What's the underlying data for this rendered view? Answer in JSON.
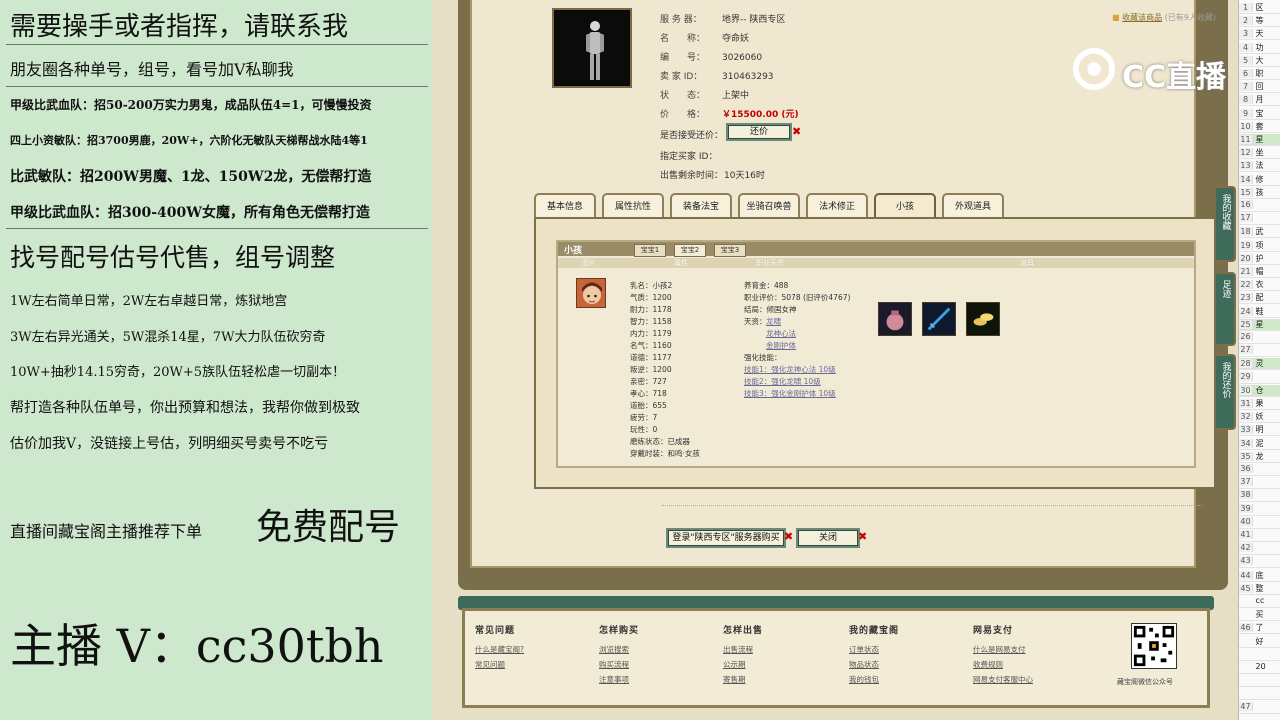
{
  "ad_panel": {
    "lines": [
      "需要操手或者指挥，请联系我",
      "朋友圈各种单号，组号，看号加V私聊我",
      "甲级比武血队：招50-200万实力男鬼，成品队伍4=1，可慢慢投资",
      "四上小资敏队：招3700男鹿，20W+，六阶化无敏队天梯帮战水陆4等1",
      "比武敏队：招200W男魔、1龙、150W2龙，无偿帮打造",
      "甲级比武血队：招300-400W女魔，所有角色无偿帮打造",
      "找号配号估号代售，组号调整",
      "1W左右简单日常，2W左右卓越日常，炼狱地宫",
      "3W左右异光通关，5W混杀14星，7W大力队伍砍穷奇",
      "10W+抽秒14.15穷奇，20W+5族队伍轻松虐一切副本！",
      "帮打造各种队伍单号，你出预算和想法，我帮你做到极致",
      "估价加我V，没链接上号估，列明细买号卖号不吃亏",
      "直播间藏宝阁主播推荐下单",
      "免费配号",
      "主播 V：cc30tbh"
    ]
  },
  "listing": {
    "server_label": "服 务 器：",
    "server_value": "地界-- 陕西专区",
    "name_label": "名　　称：",
    "name_value": "夺命妖",
    "id_label": "编　　号：",
    "id_value": "3026060",
    "seller_label": "卖 家 ID：",
    "seller_value": "310463293",
    "status_label": "状　　态：",
    "status_value": "上架中",
    "price_label": "价　　格：",
    "price_value": "￥15500.00 (元)",
    "counter_label": "是否接受还价：",
    "counter_button": "还价",
    "buyer_label": "指定买家 ID：",
    "buyer_value": "",
    "time_label": "出售剩余时间：",
    "time_value": "10天16时",
    "favorite_link": "收藏该商品",
    "favorite_count": "(已有9人收藏)"
  },
  "tabs": [
    "基本信息",
    "属性抗性",
    "装备法宝",
    "坐骑召唤兽",
    "法术修正",
    "小孩",
    "外观道具"
  ],
  "active_tab": "小孩",
  "child_panel": {
    "title": "小孩",
    "sub_tabs": [
      "宝宝1",
      "宝宝2",
      "宝宝3"
    ],
    "headers": [
      "图片",
      "属性",
      "职业天资",
      "道具"
    ],
    "attrs": [
      "乳名：小孩2",
      "气质：1200",
      "耐力：1178",
      "智力：1158",
      "内力：1179",
      "名气：1160",
      "道德：1177",
      "叛逆：1200",
      "亲密：727",
      "孝心：718",
      "道胎：655",
      "疲劳：7",
      "玩性：0",
      "磨练状态：已成器",
      "穿戴时装：和鸣·女孩"
    ],
    "career": [
      "养育金：488",
      "职业评价：5078 (旧评价4767)",
      "结局：倾国女神",
      "天资："
    ],
    "talents": [
      "龙啸",
      "龙神心法",
      "金刚护体"
    ],
    "skills_label": "强化技能：",
    "skills": [
      "技能1：强化龙神心法 10级",
      "技能2：强化龙啸 10级",
      "技能3：强化金刚护体 10级"
    ]
  },
  "buttons": {
    "buy": "登录\"陕西专区\"服务器购买",
    "close": "关闭"
  },
  "footer": {
    "columns": [
      {
        "title": "常见问题",
        "links": [
          "什么是藏宝阁?",
          "常见问题"
        ]
      },
      {
        "title": "怎样购买",
        "links": [
          "浏览搜索",
          "购买流程",
          "注意事项"
        ]
      },
      {
        "title": "怎样出售",
        "links": [
          "出售流程",
          "公示期",
          "寄售期"
        ]
      },
      {
        "title": "我的藏宝阁",
        "links": [
          "订单状态",
          "物品状态",
          "我的钱包"
        ]
      },
      {
        "title": "网易支付",
        "links": [
          "什么是网易支付",
          "收费规则",
          "网易支付客服中心"
        ]
      }
    ],
    "qr_caption": "藏宝阁微信公众号"
  },
  "side_buttons": [
    "我的收藏",
    "足迹",
    "我的还价"
  ],
  "watermark": "CC直播",
  "sheet_rows": [
    {
      "n": "1",
      "t": "区"
    },
    {
      "n": "2",
      "t": "等"
    },
    {
      "n": "3",
      "t": "天"
    },
    {
      "n": "4",
      "t": "功"
    },
    {
      "n": "5",
      "t": "大"
    },
    {
      "n": "6",
      "t": "职"
    },
    {
      "n": "7",
      "t": "回"
    },
    {
      "n": "8",
      "t": "月"
    },
    {
      "n": "9",
      "t": "宝"
    },
    {
      "n": "10",
      "t": "套"
    },
    {
      "n": "11",
      "t": "星"
    },
    {
      "n": "12",
      "t": "坐"
    },
    {
      "n": "13",
      "t": "法"
    },
    {
      "n": "14",
      "t": "修"
    },
    {
      "n": "15",
      "t": "孩"
    },
    {
      "n": "16",
      "t": ""
    },
    {
      "n": "17",
      "t": ""
    },
    {
      "n": "18",
      "t": "武"
    },
    {
      "n": "19",
      "t": "项"
    },
    {
      "n": "20",
      "t": "护"
    },
    {
      "n": "21",
      "t": "帽"
    },
    {
      "n": "22",
      "t": "衣"
    },
    {
      "n": "23",
      "t": "配"
    },
    {
      "n": "24",
      "t": "鞋"
    },
    {
      "n": "25",
      "t": "星"
    },
    {
      "n": "26",
      "t": ""
    },
    {
      "n": "27",
      "t": ""
    },
    {
      "n": "28",
      "t": "灵"
    },
    {
      "n": "29",
      "t": ""
    },
    {
      "n": "30",
      "t": "仓"
    },
    {
      "n": "31",
      "t": "果"
    },
    {
      "n": "32",
      "t": "妖"
    },
    {
      "n": "33",
      "t": "明"
    },
    {
      "n": "34",
      "t": "泥"
    },
    {
      "n": "35",
      "t": "龙"
    },
    {
      "n": "36",
      "t": ""
    },
    {
      "n": "37",
      "t": ""
    },
    {
      "n": "38",
      "t": ""
    },
    {
      "n": "39",
      "t": ""
    },
    {
      "n": "40",
      "t": ""
    },
    {
      "n": "41",
      "t": ""
    },
    {
      "n": "42",
      "t": ""
    },
    {
      "n": "43",
      "t": ""
    },
    {
      "n": "44",
      "t": "底"
    },
    {
      "n": "45",
      "t": "整"
    },
    {
      "n": "",
      "t": "cc"
    },
    {
      "n": "",
      "t": "买"
    },
    {
      "n": "46",
      "t": "了"
    },
    {
      "n": "",
      "t": "好"
    },
    {
      "n": "",
      "t": ""
    },
    {
      "n": "",
      "t": "20"
    },
    {
      "n": "",
      "t": ""
    },
    {
      "n": "",
      "t": ""
    },
    {
      "n": "47",
      "t": ""
    }
  ]
}
